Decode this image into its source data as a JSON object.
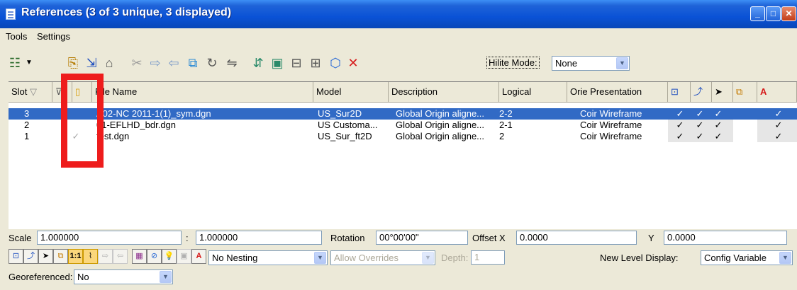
{
  "window": {
    "title": "References (3 of 3 unique, 3 displayed)"
  },
  "menu": [
    "Tools",
    "Settings"
  ],
  "toolbar": {
    "hilite_label": "Hilite Mode:",
    "hilite_value": "None"
  },
  "columns": {
    "slot": "Slot",
    "file_name": "File Name",
    "model": "Model",
    "description": "Description",
    "logical": "Logical",
    "presentation": "Orie Presentation"
  },
  "rows": [
    {
      "slot": "3",
      "file": "A02-NC 2011-1(1)_sym.dgn",
      "model": "US_Sur2D",
      "desc": "Global Origin aligne...",
      "logical": "2-2",
      "pres": "Coir Wireframe",
      "loaded": "",
      "f1": "✓",
      "f2": "✓",
      "f3": "✓",
      "f4": "✓",
      "selected": true
    },
    {
      "slot": "2",
      "file": "01-EFLHD_bdr.dgn",
      "model": "US Customa...",
      "desc": "Global Origin aligne...",
      "logical": "2-1",
      "pres": "Coir Wireframe",
      "loaded": "",
      "f1": "✓",
      "f2": "✓",
      "f3": "✓",
      "f4": "✓",
      "selected": false
    },
    {
      "slot": "1",
      "file": "test.dgn",
      "model": "US_Sur_ft2D",
      "desc": "Global Origin aligne...",
      "logical": "2",
      "pres": "Coir Wireframe",
      "loaded": "✓",
      "f1": "✓",
      "f2": "✓",
      "f3": "✓",
      "f4": "✓",
      "selected": false
    }
  ],
  "props": {
    "scale_label": "Scale",
    "scale_1": "1.000000",
    "scale_sep": ":",
    "scale_2": "1.000000",
    "rotation_label": "Rotation",
    "rotation": "00°00'00\"",
    "offset_x_label": "Offset X",
    "offset_x": "0.0000",
    "y_label": "Y",
    "y": "0.0000",
    "nesting": "No Nesting",
    "overrides": "Allow Overrides",
    "depth_label": "Depth:",
    "depth": "1",
    "new_level_label": "New Level Display:",
    "new_level": "Config Variable",
    "georef_label": "Georeferenced:",
    "georef": "No"
  },
  "colors": {
    "title_bar": "#0a52d6",
    "selection": "#316ac5",
    "highlight_box": "#ee1c1c",
    "window_bg": "#ece9d8"
  }
}
